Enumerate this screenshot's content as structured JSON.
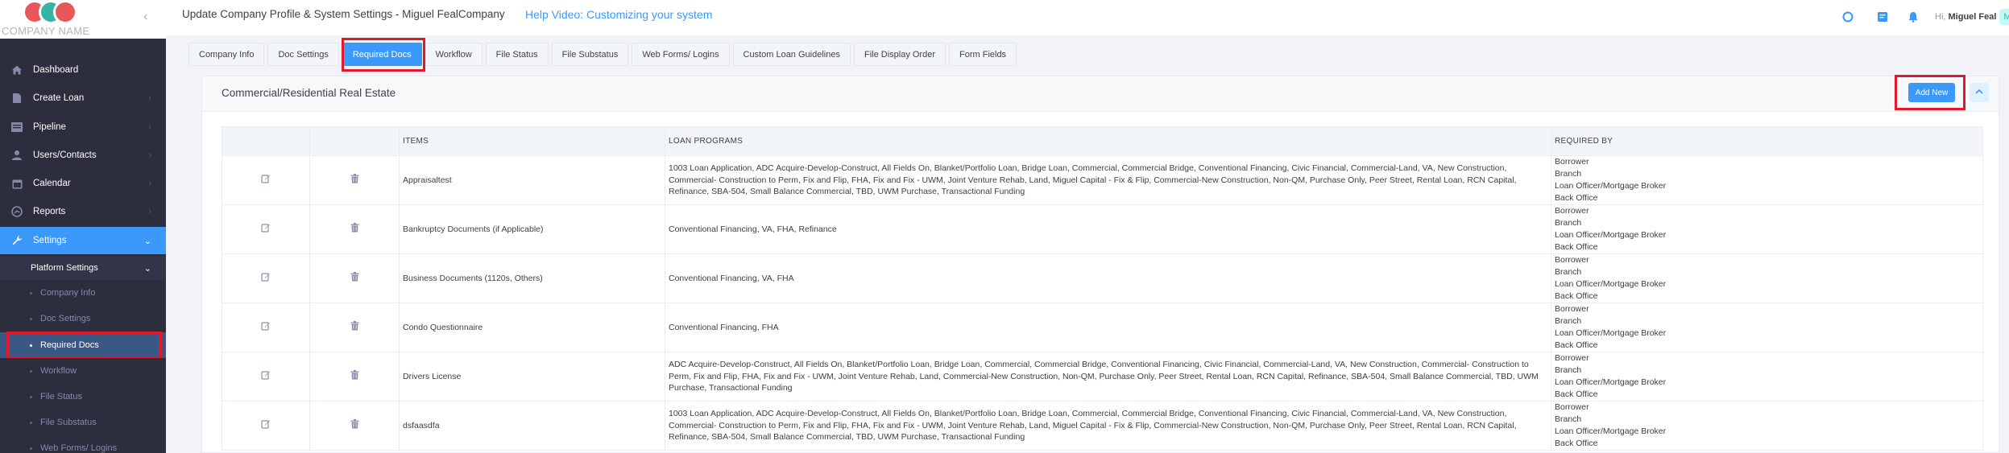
{
  "logo": {
    "company_name": "COMPANY NAME",
    "colors": [
      "#e8585a",
      "#35b5a4",
      "#e8585a"
    ]
  },
  "header": {
    "title": "Update Company Profile & System Settings - Miguel FealCompany",
    "help_link": "Help Video: Customizing your system",
    "icons": [
      "circle-icon",
      "news-icon",
      "bell-icon"
    ],
    "greeting_prefix": "Hi,",
    "user_name": "Miguel Feal",
    "avatar_letter": "M"
  },
  "sidebar": {
    "items": [
      {
        "label": "Dashboard",
        "icon": "home-icon"
      },
      {
        "label": "Create Loan",
        "icon": "file-icon"
      },
      {
        "label": "Pipeline",
        "icon": "pipeline-icon"
      },
      {
        "label": "Users/Contacts",
        "icon": "users-icon"
      },
      {
        "label": "Calendar",
        "icon": "calendar-icon"
      },
      {
        "label": "Reports",
        "icon": "reports-icon"
      },
      {
        "label": "Settings",
        "icon": "wrench-icon"
      }
    ],
    "submenu_label": "Platform Settings",
    "subitems": [
      "Company Info",
      "Doc Settings",
      "Required Docs",
      "Workflow",
      "File Status",
      "File Substatus",
      "Web Forms/ Logins"
    ]
  },
  "tabs": [
    "Company Info",
    "Doc Settings",
    "Required Docs",
    "Workflow",
    "File Status",
    "File Substatus",
    "Web Forms/ Logins",
    "Custom Loan Guidelines",
    "File Display Order",
    "Form Fields"
  ],
  "active_tab": "Required Docs",
  "card": {
    "title": "Commercial/Residential Real Estate",
    "add_new_label": "Add New",
    "accent_color": "#3b99fb",
    "highlight_color": "#e0192b"
  },
  "table": {
    "headers": {
      "edit": "",
      "delete": "",
      "items": "ITEMS",
      "programs": "LOAN PROGRAMS",
      "required_by": "REQUIRED BY"
    },
    "rows": [
      {
        "item": "Appraisaltest",
        "programs": "1003 Loan Application, ADC Acquire-Develop-Construct, All Fields On, Blanket/Portfolio Loan, Bridge Loan, Commercial, Commercial Bridge, Conventional Financing, Civic Financial, Commercial-Land, VA, New Construction, Commercial- Construction to Perm, Fix and Flip, FHA, Fix and Fix - UWM, Joint Venture Rehab, Land, Miguel Capital - Fix & Flip, Commercial-New Construction, Non-QM, Purchase Only, Peer Street, Rental Loan, RCN Capital, Refinance, SBA-504, Small Balance Commercial, TBD, UWM Purchase, Transactional Funding",
        "required_by": [
          "Borrower",
          "Branch",
          "Loan Officer/Mortgage Broker",
          "Back Office"
        ]
      },
      {
        "item": "Bankruptcy Documents (if Applicable)",
        "programs": "Conventional Financing, VA, FHA, Refinance",
        "required_by": [
          "Borrower",
          "Branch",
          "Loan Officer/Mortgage Broker",
          "Back Office"
        ]
      },
      {
        "item": "Business Documents (1120s, Others)",
        "programs": "Conventional Financing, VA, FHA",
        "required_by": [
          "Borrower",
          "Branch",
          "Loan Officer/Mortgage Broker",
          "Back Office"
        ]
      },
      {
        "item": "Condo Questionnaire",
        "programs": "Conventional Financing, FHA",
        "required_by": [
          "Borrower",
          "Branch",
          "Loan Officer/Mortgage Broker",
          "Back Office"
        ]
      },
      {
        "item": "Drivers License",
        "programs": "ADC Acquire-Develop-Construct, All Fields On, Blanket/Portfolio Loan, Bridge Loan, Commercial, Commercial Bridge, Conventional Financing, Civic Financial, Commercial-Land, VA, New Construction, Commercial- Construction to Perm, Fix and Flip, FHA, Fix and Fix - UWM, Joint Venture Rehab, Land, Commercial-New Construction, Non-QM, Purchase Only, Peer Street, Rental Loan, RCN Capital, Refinance, SBA-504, Small Balance Commercial, TBD, UWM Purchase, Transactional Funding",
        "required_by": [
          "Borrower",
          "Branch",
          "Loan Officer/Mortgage Broker",
          "Back Office"
        ]
      },
      {
        "item": "dsfaasdfa",
        "programs": "1003 Loan Application, ADC Acquire-Develop-Construct, All Fields On, Blanket/Portfolio Loan, Bridge Loan, Commercial, Commercial Bridge, Conventional Financing, Civic Financial, Commercial-Land, VA, New Construction, Commercial- Construction to Perm, Fix and Flip, FHA, Fix and Fix - UWM, Joint Venture Rehab, Land, Miguel Capital - Fix & Flip, Commercial-New Construction, Non-QM, Purchase Only, Peer Street, Rental Loan, RCN Capital, Refinance, SBA-504, Small Balance Commercial, TBD, UWM Purchase, Transactional Funding",
        "required_by": [
          "Borrower",
          "Branch",
          "Loan Officer/Mortgage Broker",
          "Back Office"
        ]
      }
    ]
  }
}
